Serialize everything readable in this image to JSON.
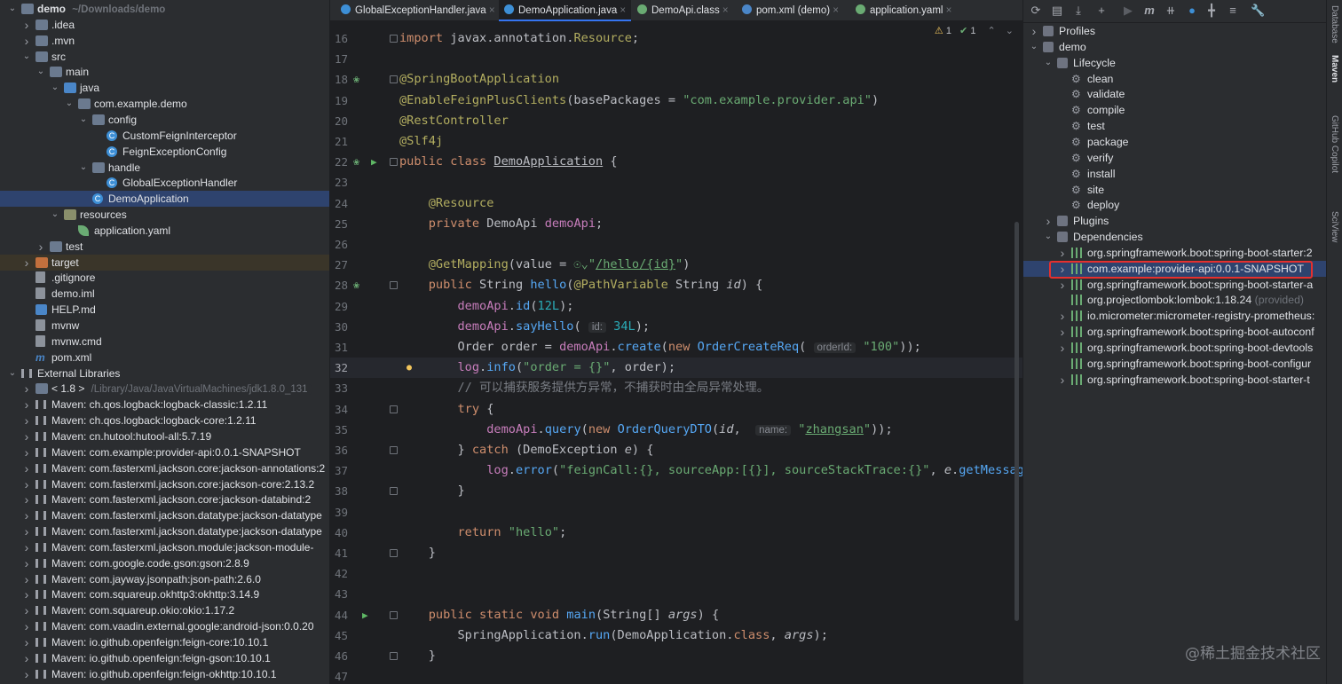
{
  "project_tree": [
    {
      "depth": 0,
      "arrow": "open",
      "icon": "folder",
      "label": "demo",
      "hint": " ~/Downloads/demo",
      "bold": true
    },
    {
      "depth": 1,
      "arrow": "closed",
      "icon": "folder",
      "label": ".idea"
    },
    {
      "depth": 1,
      "arrow": "closed",
      "icon": "folder",
      "label": ".mvn"
    },
    {
      "depth": 1,
      "arrow": "open",
      "icon": "folder",
      "label": "src"
    },
    {
      "depth": 2,
      "arrow": "open",
      "icon": "folder",
      "label": "main"
    },
    {
      "depth": 3,
      "arrow": "open",
      "icon": "folder-blue",
      "label": "java"
    },
    {
      "depth": 4,
      "arrow": "open",
      "icon": "folder",
      "label": "com.example.demo"
    },
    {
      "depth": 5,
      "arrow": "open",
      "icon": "folder",
      "label": "config"
    },
    {
      "depth": 6,
      "arrow": "none",
      "icon": "cls",
      "label": "CustomFeignInterceptor"
    },
    {
      "depth": 6,
      "arrow": "none",
      "icon": "cls",
      "label": "FeignExceptionConfig"
    },
    {
      "depth": 5,
      "arrow": "open",
      "icon": "folder",
      "label": "handle"
    },
    {
      "depth": 6,
      "arrow": "none",
      "icon": "cls",
      "label": "GlobalExceptionHandler"
    },
    {
      "depth": 5,
      "arrow": "none",
      "icon": "cls",
      "label": "DemoApplication",
      "selected": true
    },
    {
      "depth": 3,
      "arrow": "open",
      "icon": "folder-res",
      "label": "resources"
    },
    {
      "depth": 4,
      "arrow": "none",
      "icon": "leaf",
      "label": "application.yaml"
    },
    {
      "depth": 2,
      "arrow": "closed",
      "icon": "folder",
      "label": "test"
    },
    {
      "depth": 1,
      "arrow": "closed",
      "icon": "folder-orange",
      "label": "target",
      "highlight": true
    },
    {
      "depth": 1,
      "arrow": "none",
      "icon": "file",
      "label": ".gitignore"
    },
    {
      "depth": 1,
      "arrow": "none",
      "icon": "file",
      "label": "demo.iml"
    },
    {
      "depth": 1,
      "arrow": "none",
      "icon": "md",
      "label": "HELP.md"
    },
    {
      "depth": 1,
      "arrow": "none",
      "icon": "file",
      "label": "mvnw"
    },
    {
      "depth": 1,
      "arrow": "none",
      "icon": "file",
      "label": "mvnw.cmd"
    },
    {
      "depth": 1,
      "arrow": "none",
      "icon": "m",
      "label": "pom.xml"
    },
    {
      "depth": 0,
      "arrow": "open",
      "icon": "lib",
      "label": "External Libraries"
    },
    {
      "depth": 1,
      "arrow": "closed",
      "icon": "folder",
      "label": "< 1.8 >",
      "hint": " /Library/Java/JavaVirtualMachines/jdk1.8.0_131"
    },
    {
      "depth": 1,
      "arrow": "closed",
      "icon": "lib",
      "label": "Maven: ch.qos.logback:logback-classic:1.2.11"
    },
    {
      "depth": 1,
      "arrow": "closed",
      "icon": "lib",
      "label": "Maven: ch.qos.logback:logback-core:1.2.11"
    },
    {
      "depth": 1,
      "arrow": "closed",
      "icon": "lib",
      "label": "Maven: cn.hutool:hutool-all:5.7.19"
    },
    {
      "depth": 1,
      "arrow": "closed",
      "icon": "lib",
      "label": "Maven: com.example:provider-api:0.0.1-SNAPSHOT"
    },
    {
      "depth": 1,
      "arrow": "closed",
      "icon": "lib",
      "label": "Maven: com.fasterxml.jackson.core:jackson-annotations:2"
    },
    {
      "depth": 1,
      "arrow": "closed",
      "icon": "lib",
      "label": "Maven: com.fasterxml.jackson.core:jackson-core:2.13.2"
    },
    {
      "depth": 1,
      "arrow": "closed",
      "icon": "lib",
      "label": "Maven: com.fasterxml.jackson.core:jackson-databind:2"
    },
    {
      "depth": 1,
      "arrow": "closed",
      "icon": "lib",
      "label": "Maven: com.fasterxml.jackson.datatype:jackson-datatype"
    },
    {
      "depth": 1,
      "arrow": "closed",
      "icon": "lib",
      "label": "Maven: com.fasterxml.jackson.datatype:jackson-datatype"
    },
    {
      "depth": 1,
      "arrow": "closed",
      "icon": "lib",
      "label": "Maven: com.fasterxml.jackson.module:jackson-module-"
    },
    {
      "depth": 1,
      "arrow": "closed",
      "icon": "lib",
      "label": "Maven: com.google.code.gson:gson:2.8.9"
    },
    {
      "depth": 1,
      "arrow": "closed",
      "icon": "lib",
      "label": "Maven: com.jayway.jsonpath:json-path:2.6.0"
    },
    {
      "depth": 1,
      "arrow": "closed",
      "icon": "lib",
      "label": "Maven: com.squareup.okhttp3:okhttp:3.14.9"
    },
    {
      "depth": 1,
      "arrow": "closed",
      "icon": "lib",
      "label": "Maven: com.squareup.okio:okio:1.17.2"
    },
    {
      "depth": 1,
      "arrow": "closed",
      "icon": "lib",
      "label": "Maven: com.vaadin.external.google:android-json:0.0.20"
    },
    {
      "depth": 1,
      "arrow": "closed",
      "icon": "lib",
      "label": "Maven: io.github.openfeign:feign-core:10.10.1"
    },
    {
      "depth": 1,
      "arrow": "closed",
      "icon": "lib",
      "label": "Maven: io.github.openfeign:feign-gson:10.10.1"
    },
    {
      "depth": 1,
      "arrow": "closed",
      "icon": "lib",
      "label": "Maven: io.github.openfeign:feign-okhttp:10.10.1"
    }
  ],
  "tabs": [
    {
      "label": "GlobalExceptionHandler.java",
      "color": "#3d8fd6",
      "active": false
    },
    {
      "label": "DemoApplication.java",
      "color": "#3d8fd6",
      "active": true
    },
    {
      "label": "DemoApi.class",
      "color": "#6aab73",
      "active": false
    },
    {
      "label": "pom.xml (demo)",
      "color": "#4a86c8",
      "active": false
    },
    {
      "label": "application.yaml",
      "color": "#6aab73",
      "active": false
    }
  ],
  "inspections": {
    "warnings": "1",
    "ok": "1"
  },
  "editor_lines": [
    {
      "n": "16",
      "code": "<span class='kw'>import</span> javax.annotation.<span class='an'>Resource</span>;"
    },
    {
      "n": "17",
      "code": ""
    },
    {
      "n": "18",
      "code": "<span class='an'>@SpringBootApplication</span>",
      "gutter": "bean"
    },
    {
      "n": "19",
      "code": "<span class='an'>@EnableFeignPlusClients</span>(basePackages = <span class='st'>\"com.example.provider.api\"</span>)"
    },
    {
      "n": "20",
      "code": "<span class='an'>@RestController</span>"
    },
    {
      "n": "21",
      "code": "<span class='an'>@Slf4j</span>"
    },
    {
      "n": "22",
      "code": "<span class='kw'>public class</span> <span class='ul'>DemoApplication</span> {",
      "gutter": "bean-run"
    },
    {
      "n": "23",
      "code": ""
    },
    {
      "n": "24",
      "code": "    <span class='an'>@Resource</span>"
    },
    {
      "n": "25",
      "code": "    <span class='kw'>private</span> DemoApi <span class='fd'>demoApi</span>;"
    },
    {
      "n": "26",
      "code": ""
    },
    {
      "n": "27",
      "code": "    <span class='an'>@GetMapping</span>(value = <span class='st'>&#x2609;&#x2304;\"<span class='ul'>/hello/{id}</span>\"</span>)"
    },
    {
      "n": "28",
      "code": "    <span class='kw'>public</span> String <span class='fn'>hello</span>(<span class='an'>@PathVariable</span> String <span class='pa'>id</span>) {",
      "gutter": "bean"
    },
    {
      "n": "29",
      "code": "        <span class='fd'>demoApi</span>.<span class='fn'>id</span>(<span class='nu'>12L</span>);"
    },
    {
      "n": "30",
      "code": "        <span class='fd'>demoApi</span>.<span class='fn'>sayHello</span>( <span class='hint'>id:</span> <span class='nu'>34L</span>);"
    },
    {
      "n": "31",
      "code": "        Order order = <span class='fd'>demoApi</span>.<span class='fn'>create</span>(<span class='kw'>new</span> <span class='fn'>OrderCreateReq</span>( <span class='hint'>orderId:</span> <span class='st'>\"100\"</span>));"
    },
    {
      "n": "32",
      "code": "        <span class='fd'>log</span>.<span class='fn'>info</span>(<span class='st'>\"order = {}\"</span>, order);",
      "current": true,
      "gutter": "bulb"
    },
    {
      "n": "33",
      "code": "        <span class='cm'>// 可以捕获服务提供方异常，不捕获时由全局异常处理。</span>"
    },
    {
      "n": "34",
      "code": "        <span class='kw'>try</span> {"
    },
    {
      "n": "35",
      "code": "            <span class='fd'>demoApi</span>.<span class='fn'>query</span>(<span class='kw'>new</span> <span class='fn'>OrderQueryDTO</span>(<span class='pa'>id</span>,  <span class='hint'>name:</span> <span class='st'>\"<span class='ul'>zhangsan</span>\"</span>));"
    },
    {
      "n": "36",
      "code": "        } <span class='kw'>catch</span> (DemoException <span class='pa'>e</span>) {"
    },
    {
      "n": "37",
      "code": "            <span class='fd'>log</span>.<span class='fn'>error</span>(<span class='st'>\"feignCall:{}, sourceApp:[{}], sourceStackTrace:{}\"</span>, <span class='pa'>e</span>.<span class='fn'>getMessage</span>"
    },
    {
      "n": "38",
      "code": "        }"
    },
    {
      "n": "39",
      "code": ""
    },
    {
      "n": "40",
      "code": "        <span class='kw'>return</span> <span class='st'>\"hello\"</span>;"
    },
    {
      "n": "41",
      "code": "    }"
    },
    {
      "n": "42",
      "code": ""
    },
    {
      "n": "43",
      "code": ""
    },
    {
      "n": "44",
      "code": "    <span class='kw'>public static void</span> <span class='fn'>main</span>(String[] <span class='pa'>args</span>) {",
      "gutter": "run"
    },
    {
      "n": "45",
      "code": "        SpringApplication.<span class='fn'>run</span>(DemoApplication.<span class='kw'>class</span>, <span class='pa'>args</span>);"
    },
    {
      "n": "46",
      "code": "    }"
    },
    {
      "n": "47",
      "code": ""
    }
  ],
  "maven_tree": [
    {
      "depth": 0,
      "arrow": "closed",
      "icon": "maven-ico",
      "label": "Profiles"
    },
    {
      "depth": 0,
      "arrow": "open",
      "icon": "maven-ico",
      "label": "demo"
    },
    {
      "depth": 1,
      "arrow": "open",
      "icon": "maven-ico",
      "label": "Lifecycle"
    },
    {
      "depth": 2,
      "arrow": "none",
      "icon": "gear",
      "label": "clean"
    },
    {
      "depth": 2,
      "arrow": "none",
      "icon": "gear",
      "label": "validate"
    },
    {
      "depth": 2,
      "arrow": "none",
      "icon": "gear",
      "label": "compile"
    },
    {
      "depth": 2,
      "arrow": "none",
      "icon": "gear",
      "label": "test"
    },
    {
      "depth": 2,
      "arrow": "none",
      "icon": "gear",
      "label": "package"
    },
    {
      "depth": 2,
      "arrow": "none",
      "icon": "gear",
      "label": "verify"
    },
    {
      "depth": 2,
      "arrow": "none",
      "icon": "gear",
      "label": "install"
    },
    {
      "depth": 2,
      "arrow": "none",
      "icon": "gear",
      "label": "site"
    },
    {
      "depth": 2,
      "arrow": "none",
      "icon": "gear",
      "label": "deploy"
    },
    {
      "depth": 1,
      "arrow": "closed",
      "icon": "maven-ico",
      "label": "Plugins"
    },
    {
      "depth": 1,
      "arrow": "open",
      "icon": "maven-ico",
      "label": "Dependencies"
    },
    {
      "depth": 2,
      "arrow": "closed",
      "icon": "libbar",
      "label": "org.springframework.boot:spring-boot-starter:2"
    },
    {
      "depth": 2,
      "arrow": "closed",
      "icon": "libbar",
      "label": "com.example:provider-api:0.0.1-SNAPSHOT",
      "selected": true
    },
    {
      "depth": 2,
      "arrow": "closed",
      "icon": "libbar",
      "label": "org.springframework.boot:spring-boot-starter-a"
    },
    {
      "depth": 2,
      "arrow": "none",
      "icon": "libbar",
      "label": "org.projectlombok:lombok:1.18.24",
      "hint": " (provided)"
    },
    {
      "depth": 2,
      "arrow": "closed",
      "icon": "libbar",
      "label": "io.micrometer:micrometer-registry-prometheus:"
    },
    {
      "depth": 2,
      "arrow": "closed",
      "icon": "libbar",
      "label": "org.springframework.boot:spring-boot-autoconf"
    },
    {
      "depth": 2,
      "arrow": "closed",
      "icon": "libbar",
      "label": "org.springframework.boot:spring-boot-devtools"
    },
    {
      "depth": 2,
      "arrow": "none",
      "icon": "libbar",
      "label": "org.springframework.boot:spring-boot-configur"
    },
    {
      "depth": 2,
      "arrow": "closed",
      "icon": "libbar",
      "label": "org.springframework.boot:spring-boot-starter-t"
    }
  ],
  "right_strip": [
    "Database",
    "Maven",
    "GitHub Copilot",
    "SciView"
  ],
  "watermark": "@稀土掘金技术社区"
}
